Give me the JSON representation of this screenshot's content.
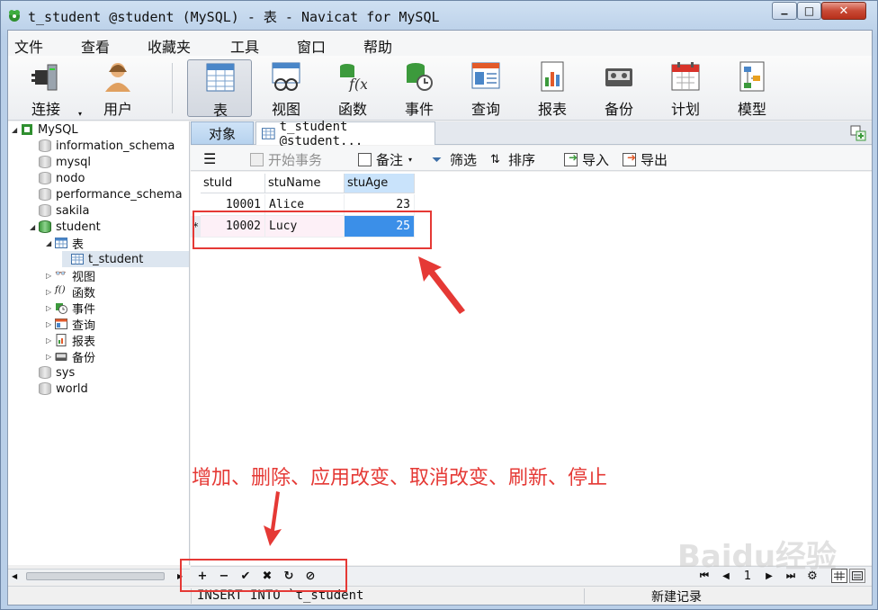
{
  "window": {
    "title": "t_student @student (MySQL) - 表 - Navicat for MySQL",
    "min_glyph": "▁",
    "max_glyph": "□",
    "close_glyph": "✕"
  },
  "menu": [
    "文件",
    "查看",
    "收藏夹",
    "工具",
    "窗口",
    "帮助"
  ],
  "toolbar": {
    "items": [
      {
        "label": "连接",
        "icon": "plug-icon"
      },
      {
        "label": "用户",
        "icon": "user-icon"
      },
      {
        "label": "表",
        "icon": "table-icon",
        "active": true
      },
      {
        "label": "视图",
        "icon": "view-icon"
      },
      {
        "label": "函数",
        "icon": "function-icon"
      },
      {
        "label": "事件",
        "icon": "event-icon"
      },
      {
        "label": "查询",
        "icon": "query-icon"
      },
      {
        "label": "报表",
        "icon": "report-icon"
      },
      {
        "label": "备份",
        "icon": "backup-icon"
      },
      {
        "label": "计划",
        "icon": "schedule-icon"
      },
      {
        "label": "模型",
        "icon": "model-icon"
      }
    ],
    "dropdown_glyph": "▾"
  },
  "tree": {
    "root": "MySQL",
    "databases": [
      "information_schema",
      "mysql",
      "nodo",
      "performance_schema",
      "sakila",
      "student"
    ],
    "student_children": {
      "tables_label": "表",
      "table": "t_student",
      "others": [
        "视图",
        "函数",
        "事件",
        "查询",
        "报表",
        "备份"
      ]
    },
    "after": [
      "sys",
      "world"
    ],
    "expand_glyph": "◢",
    "collapse_glyph": "▷",
    "func_glyph": "f()"
  },
  "tabs": {
    "objects": "对象",
    "table_tab": "t_student @student..."
  },
  "gridbar": {
    "menu_glyph": "☰",
    "begin_tx": "开始事务",
    "notes": "备注",
    "filter": "筛选",
    "sort": "排序",
    "import": "导入",
    "export": "导出"
  },
  "grid": {
    "columns": [
      "stuId",
      "stuName",
      "stuAge"
    ],
    "rows": [
      {
        "stuId": "10001",
        "stuName": "Alice",
        "stuAge": "23"
      },
      {
        "stuId": "10002",
        "stuName": "Lucy",
        "stuAge": "25"
      }
    ],
    "row_marker": "*"
  },
  "annotation": {
    "text": "增加、删除、应用改变、取消改变、刷新、停止"
  },
  "nav": {
    "buttons": [
      "+",
      "−",
      "✔",
      "✖",
      "↻",
      "⊘"
    ],
    "first": "⏮",
    "prev": "◀",
    "page": "1",
    "next": "▶",
    "last": "⏭",
    "settings": "⚙"
  },
  "status": {
    "sql": "INSERT INTO `t_student",
    "record": "新建记录"
  },
  "watermark": "Baidu经验",
  "colors": {
    "accent": "#3b8fe8",
    "annotation": "#e53935",
    "selected_header": "#c9e3fb"
  }
}
